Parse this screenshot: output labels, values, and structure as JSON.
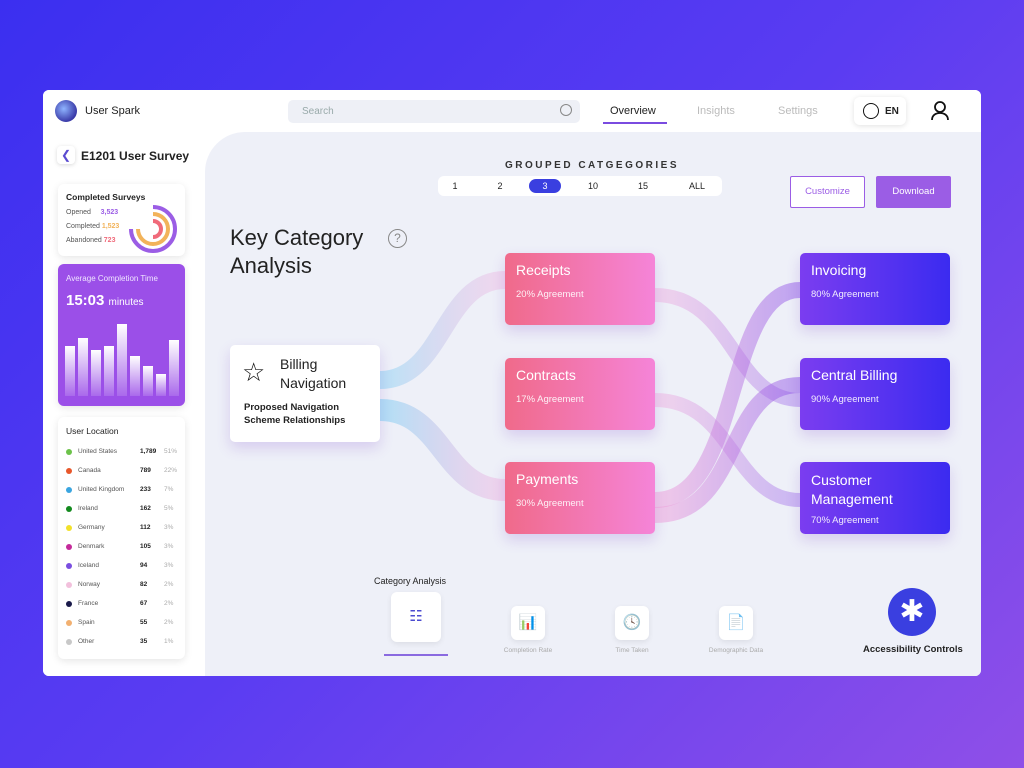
{
  "header": {
    "brand": "User Spark",
    "search_placeholder": "Search",
    "nav": [
      "Overview",
      "Insights",
      "Settings"
    ],
    "active_nav": "Overview",
    "language": "EN"
  },
  "sidebar": {
    "survey_title": "E1201 User Survey",
    "completed": {
      "title": "Completed Surveys",
      "rows": [
        {
          "label": "Opened",
          "value": "3,523",
          "color": "#9b5de5"
        },
        {
          "label": "Completed",
          "value": "1,523",
          "color": "#f2b35a"
        },
        {
          "label": "Abandoned",
          "value": "723",
          "color": "#f06a7a"
        }
      ]
    },
    "avg_time": {
      "label": "Average Completion Time",
      "value": "15:03",
      "unit": "minutes",
      "bars": [
        0.62,
        0.72,
        0.58,
        0.62,
        0.9,
        0.5,
        0.38,
        0.28,
        0.7
      ]
    },
    "location": {
      "title": "User Location",
      "rows": [
        {
          "country": "United States",
          "count": "1,789",
          "pct": "51%",
          "color": "#6cc24a"
        },
        {
          "country": "Canada",
          "count": "789",
          "pct": "22%",
          "color": "#e8572a"
        },
        {
          "country": "United Kingdom",
          "count": "233",
          "pct": "7%",
          "color": "#3aa5e0"
        },
        {
          "country": "Ireland",
          "count": "162",
          "pct": "5%",
          "color": "#138a1e"
        },
        {
          "country": "Germany",
          "count": "112",
          "pct": "3%",
          "color": "#f2e12a"
        },
        {
          "country": "Denmark",
          "count": "105",
          "pct": "3%",
          "color": "#c42a9a"
        },
        {
          "country": "Iceland",
          "count": "94",
          "pct": "3%",
          "color": "#7a4ee0"
        },
        {
          "country": "Norway",
          "count": "82",
          "pct": "2%",
          "color": "#f2c0dc"
        },
        {
          "country": "France",
          "count": "67",
          "pct": "2%",
          "color": "#1a1a4a"
        },
        {
          "country": "Spain",
          "count": "55",
          "pct": "2%",
          "color": "#f2b070"
        },
        {
          "country": "Other",
          "count": "35",
          "pct": "1%",
          "color": "#c8c8c8"
        }
      ]
    }
  },
  "main": {
    "group_title": "GROUPED CATGEGORIES",
    "groups": [
      "1",
      "2",
      "3",
      "10",
      "15",
      "ALL"
    ],
    "selected_group": "3",
    "customize": "Customize",
    "download": "Download",
    "title_line1": "Key Category",
    "title_line2": "Analysis",
    "source": {
      "title_line1": "Billing",
      "title_line2": "Navigation",
      "subtitle_line1": "Proposed Navigation",
      "subtitle_line2": "Scheme Relationships"
    },
    "middle": [
      {
        "title": "Receipts",
        "sub": "20% Agreement"
      },
      {
        "title": "Contracts",
        "sub": "17% Agreement"
      },
      {
        "title": "Payments",
        "sub": "30% Agreement"
      }
    ],
    "targets": [
      {
        "title": "Invoicing",
        "sub": "80% Agreement"
      },
      {
        "title": "Central Billing",
        "sub": "90% Agreement"
      },
      {
        "title_line1": "Customer",
        "title_line2": "Management",
        "sub": "70% Agreement"
      }
    ],
    "tabs_title": "Category Analysis",
    "tabs": [
      "Completion Rate",
      "Time Taken",
      "Demographic Data"
    ],
    "accessibility": "Accessibility Controls"
  }
}
